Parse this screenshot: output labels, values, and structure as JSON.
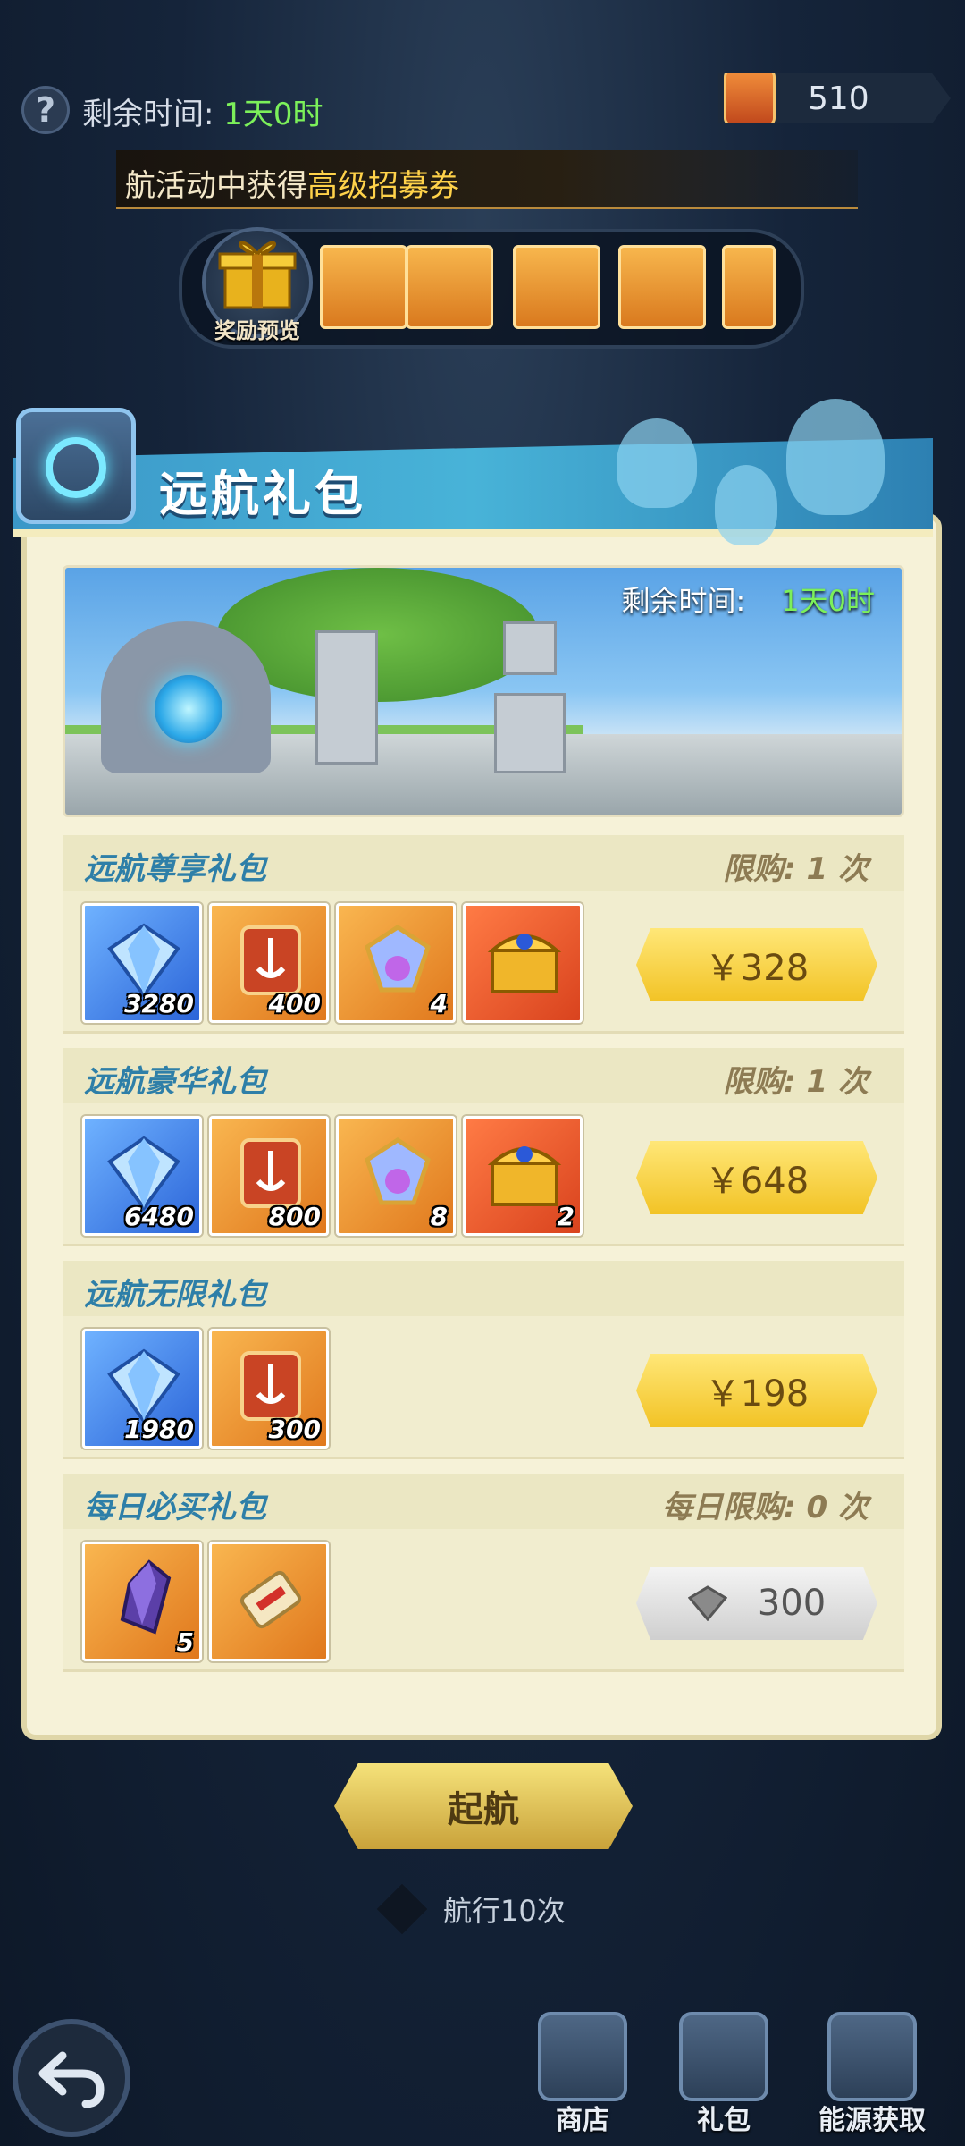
{
  "top": {
    "help_label": "?",
    "time_label": "剩余时间: ",
    "time_value": "1天0时",
    "currency_value": "510",
    "marquee_prefix": "航活动中获得",
    "marquee_highlight": "高级招募券",
    "reward_preview_label": "奖励预览"
  },
  "panel": {
    "title": "远航礼包",
    "banner_time_label": "剩余时间:",
    "banner_time_value": "1天0时"
  },
  "packs": [
    {
      "name": "远航尊享礼包",
      "limit": "限购: 1 次",
      "items": [
        {
          "icon": "diamond-icon",
          "count": "3280"
        },
        {
          "icon": "anchor-ticket-icon",
          "count": "400"
        },
        {
          "icon": "gem-crest-icon",
          "count": "4"
        },
        {
          "icon": "treasure-chest-icon",
          "count": ""
        }
      ],
      "price": "￥328"
    },
    {
      "name": "远航豪华礼包",
      "limit": "限购: 1 次",
      "items": [
        {
          "icon": "diamond-icon",
          "count": "6480"
        },
        {
          "icon": "anchor-ticket-icon",
          "count": "800"
        },
        {
          "icon": "gem-crest-icon",
          "count": "8"
        },
        {
          "icon": "treasure-chest-icon",
          "count": "2"
        }
      ],
      "price": "￥648"
    },
    {
      "name": "远航无限礼包",
      "limit": "",
      "items": [
        {
          "icon": "diamond-icon",
          "count": "1980"
        },
        {
          "icon": "anchor-ticket-icon",
          "count": "300"
        }
      ],
      "price": "￥198"
    },
    {
      "name": "每日必买礼包",
      "limit": "每日限购: 0 次",
      "items": [
        {
          "icon": "purple-crystal-icon",
          "count": "5"
        },
        {
          "icon": "scroll-icon",
          "count": ""
        }
      ],
      "price": "300"
    }
  ],
  "bottom": {
    "sail_label": "起航",
    "voyage_label": "航行10次",
    "nav": [
      {
        "label": "商店"
      },
      {
        "label": "礼包"
      },
      {
        "label": "能源获取"
      }
    ]
  },
  "colors": {
    "accent_blue": "#2e7fa8",
    "price_yellow": "#f2c326",
    "time_green": "#7cf05a"
  }
}
